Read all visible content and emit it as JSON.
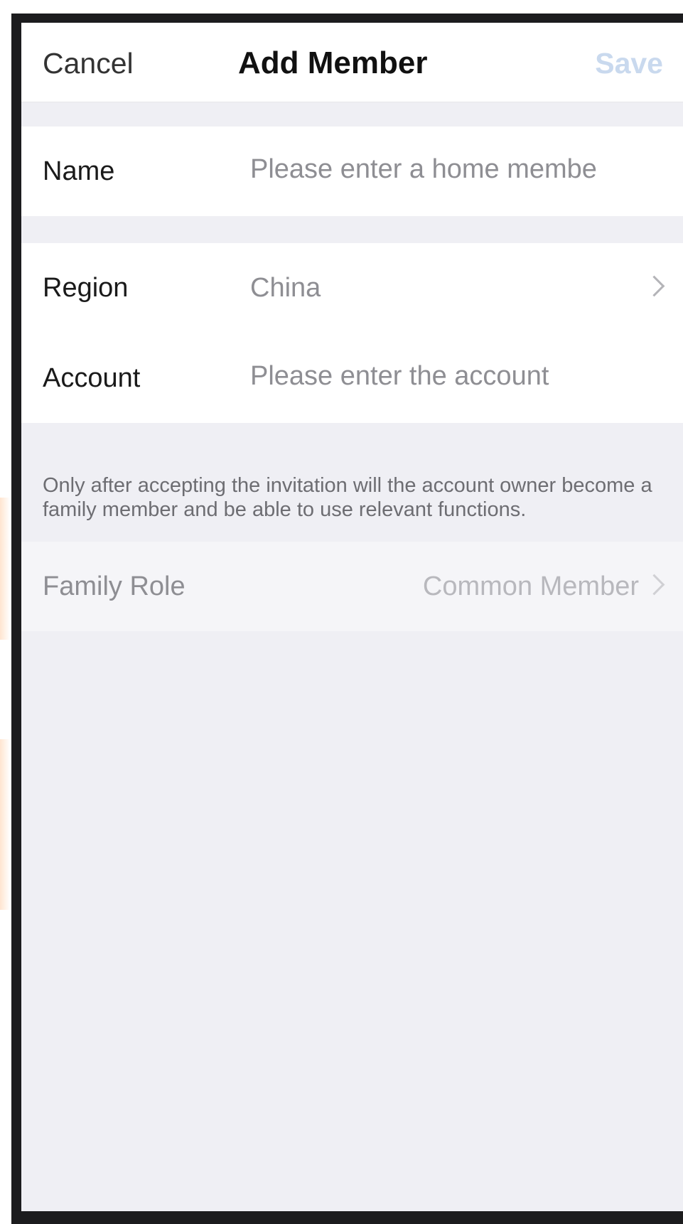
{
  "nav": {
    "cancel_label": "Cancel",
    "title": "Add Member",
    "save_label": "Save"
  },
  "form": {
    "name": {
      "label": "Name",
      "placeholder": "Please enter a home membe"
    },
    "region": {
      "label": "Region",
      "value": "China"
    },
    "account": {
      "label": "Account",
      "placeholder": "Please enter the account"
    },
    "note": "Only after accepting the invitation will the account owner become a family member and be able to use relevant functions.",
    "family_role": {
      "label": "Family Role",
      "value": "Common Member"
    }
  },
  "icons": {
    "region_chevron": "chevron-right-icon",
    "role_chevron": "chevron-right-icon"
  },
  "colors": {
    "background": "#efeff4",
    "save_disabled": "#c9d9ee",
    "placeholder": "#8e8e93"
  }
}
